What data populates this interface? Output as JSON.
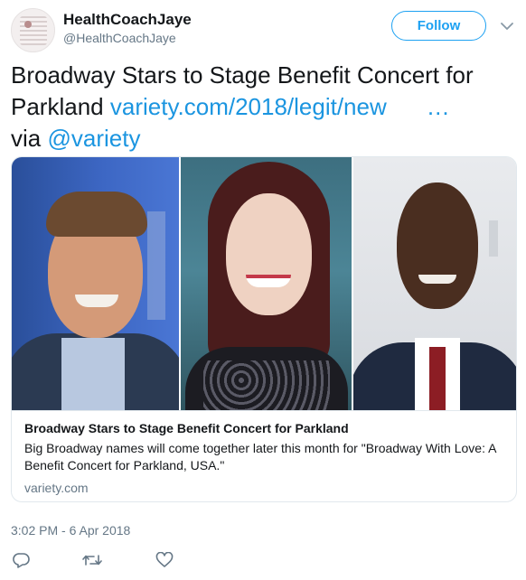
{
  "user": {
    "display_name": "HealthCoachJaye",
    "handle": "@HealthCoachJaye"
  },
  "follow_label": "Follow",
  "tweet": {
    "text": "Broadway Stars to Stage Benefit Concert for Parkland",
    "link": "variety.com/2018/legit/new",
    "ellipsis": "…",
    "via": "via",
    "mention": "@variety"
  },
  "card": {
    "title": "Broadway Stars to Stage Benefit Concert for Parkland",
    "description": "Big Broadway names will come together later this month for \"Broadway With Love: A Benefit Concert for Parkland, USA.\"",
    "domain": "variety.com"
  },
  "timestamp": "3:02 PM - 6 Apr 2018",
  "icons": {
    "reply": "reply-icon",
    "retweet": "retweet-icon",
    "like": "heart-icon",
    "menu": "chevron-down-icon"
  },
  "colors": {
    "accent": "#1da1f2",
    "link": "#1b95e0",
    "muted": "#657786",
    "border": "#e1e8ed"
  }
}
